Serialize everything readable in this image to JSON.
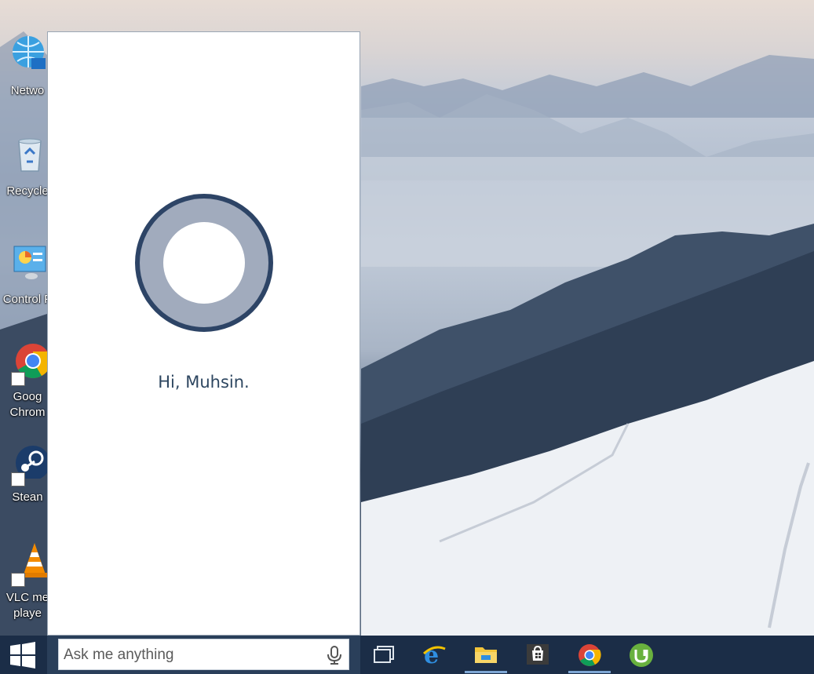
{
  "desktop": {
    "icons": [
      {
        "name": "desktop-icon-network",
        "label": "Netwo"
      },
      {
        "name": "desktop-icon-recycle-bin",
        "label": "Recycle"
      },
      {
        "name": "desktop-icon-control-panel",
        "label": "Control P"
      },
      {
        "name": "desktop-icon-google-chrome",
        "label": "Goog\nChrom"
      },
      {
        "name": "desktop-icon-steam",
        "label": "Stean"
      },
      {
        "name": "desktop-icon-vlc",
        "label": "VLC me\nplaye"
      }
    ]
  },
  "cortana": {
    "greeting": "Hi, Muhsin.",
    "logo_outer_color": "#2d4466",
    "logo_ring_color": "#a1abbd"
  },
  "taskbar": {
    "search_placeholder": "Ask me anything",
    "icons": [
      "task-view-icon",
      "internet-explorer-icon",
      "file-explorer-icon",
      "store-icon",
      "chrome-icon",
      "utorrent-icon"
    ],
    "background_color": "#1b2d47",
    "active_indicator_color": "#7ea6d4"
  }
}
